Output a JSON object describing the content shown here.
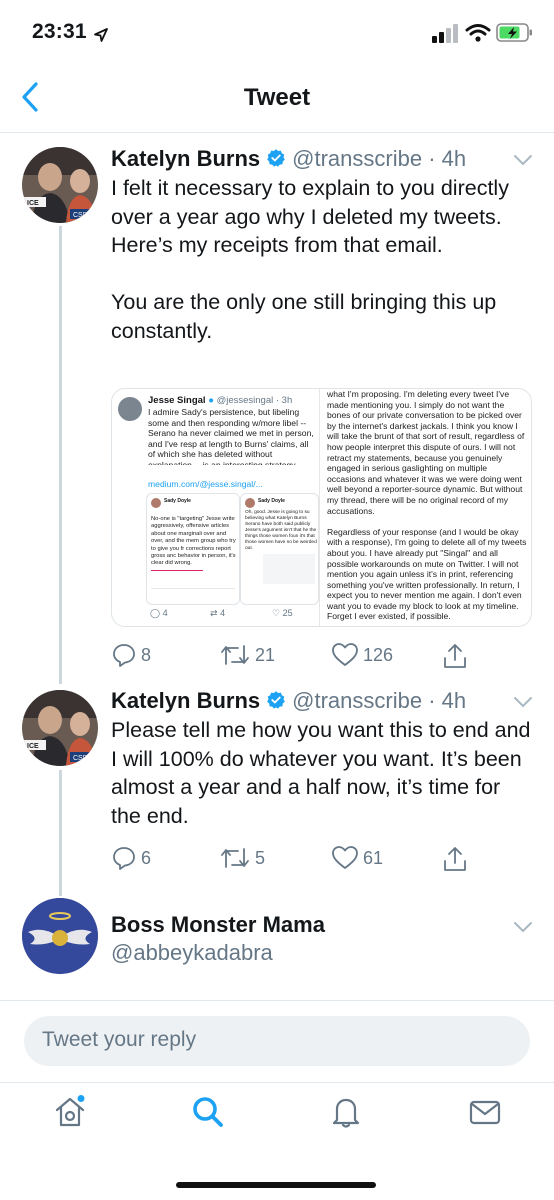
{
  "status_bar": {
    "time": "23:31"
  },
  "header": {
    "title": "Tweet"
  },
  "tweets": [
    {
      "name": "Katelyn Burns",
      "handle": "@transscribe · 4h",
      "text": "I felt it necessary to explain to you directly over a year ago why I deleted my tweets. Here’s my receipts from that email.\n\nYou are the only one still bringing this up constantly.",
      "replies": "8",
      "retweets": "21",
      "likes": "126",
      "media": {
        "name": "Jesse Singal",
        "handle": "@jessesingal · 3h",
        "text": "I admire Sady's persistence, but libeling some and then responding w/more libel -- Serano ha never claimed we met in person, and I've resp at length to Burns' claims, all of which she has deleted without explanation -- is an interesting strategy",
        "link": "medium.com/@jesse.singal/...",
        "quote_name": "Sady Doyle",
        "quote_text": "No-one is \"targeting\" Jesse write aggressively, offensive articles about one marginali over and over, and the mem group who try to give you fr corrections report gross anc behavior in person, it's clear did wrong.",
        "quote2_name": "Sady Doyle",
        "quote2_text": "Oh, good. Jesse is going to su believing what Katelyn Burns Serano have both said publicly Jesse's argument isn't that he the things those women foun it's that those women have no be weirded out.",
        "counts": {
          "replies": "4",
          "retweets": "4",
          "likes": "25"
        },
        "email_text": "what I'm proposing. I'm deleting every tweet I've made mentioning you. I simply do not want the bones of our private conversation to be picked over by the internet's darkest jackals. I think you know I will take the brunt of that sort of result, regardless of how people interpret this dispute of ours. I will not retract my statements, because you genuinely engaged in serious gaslighting on multiple occasions and whatever it was we were doing went well beyond a reporter-source dynamic. But without my thread, there will be no original record of my accusations.\n\nRegardless of your response (and I would be okay with a response), I'm going to delete all of my tweets about you. I have already put \"Singal\" and all possible workarounds on mute on Twitter. I will not mention you again unless it's in print, referencing something you've written professionally. In return, I expect you to never mention me again. I don't even want you to evade my block to look at my timeline. Forget I ever existed, if possible."
      }
    },
    {
      "name": "Katelyn Burns",
      "handle": "@transscribe · 4h",
      "text": "Please tell me how you want this to end and I will 100% do whatever you want. It’s been almost a year and a half now, it’s time for the end.",
      "replies": "6",
      "retweets": "5",
      "likes": "61"
    },
    {
      "name": "Boss Monster Mama",
      "handle": "@abbeykadabra"
    }
  ],
  "reply": {
    "placeholder": "Tweet your reply"
  },
  "colors": {
    "accent": "#1da1f2",
    "secondary_text": "#657786",
    "divider": "#e1e8ed"
  },
  "icons": [
    "back-chevron-icon",
    "verified-badge-icon",
    "chevron-down-icon",
    "reply-icon",
    "retweet-icon",
    "like-icon",
    "share-icon",
    "home-icon",
    "search-icon",
    "notifications-icon",
    "messages-icon"
  ]
}
